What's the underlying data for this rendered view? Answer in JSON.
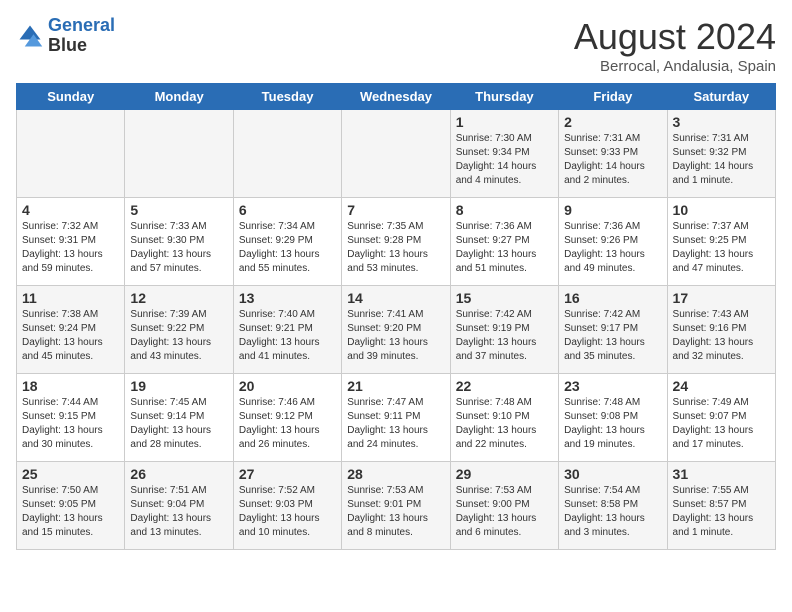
{
  "header": {
    "logo_line1": "General",
    "logo_line2": "Blue",
    "month_year": "August 2024",
    "location": "Berrocal, Andalusia, Spain"
  },
  "days_of_week": [
    "Sunday",
    "Monday",
    "Tuesday",
    "Wednesday",
    "Thursday",
    "Friday",
    "Saturday"
  ],
  "weeks": [
    [
      {
        "num": "",
        "info": ""
      },
      {
        "num": "",
        "info": ""
      },
      {
        "num": "",
        "info": ""
      },
      {
        "num": "",
        "info": ""
      },
      {
        "num": "1",
        "info": "Sunrise: 7:30 AM\nSunset: 9:34 PM\nDaylight: 14 hours\nand 4 minutes."
      },
      {
        "num": "2",
        "info": "Sunrise: 7:31 AM\nSunset: 9:33 PM\nDaylight: 14 hours\nand 2 minutes."
      },
      {
        "num": "3",
        "info": "Sunrise: 7:31 AM\nSunset: 9:32 PM\nDaylight: 14 hours\nand 1 minute."
      }
    ],
    [
      {
        "num": "4",
        "info": "Sunrise: 7:32 AM\nSunset: 9:31 PM\nDaylight: 13 hours\nand 59 minutes."
      },
      {
        "num": "5",
        "info": "Sunrise: 7:33 AM\nSunset: 9:30 PM\nDaylight: 13 hours\nand 57 minutes."
      },
      {
        "num": "6",
        "info": "Sunrise: 7:34 AM\nSunset: 9:29 PM\nDaylight: 13 hours\nand 55 minutes."
      },
      {
        "num": "7",
        "info": "Sunrise: 7:35 AM\nSunset: 9:28 PM\nDaylight: 13 hours\nand 53 minutes."
      },
      {
        "num": "8",
        "info": "Sunrise: 7:36 AM\nSunset: 9:27 PM\nDaylight: 13 hours\nand 51 minutes."
      },
      {
        "num": "9",
        "info": "Sunrise: 7:36 AM\nSunset: 9:26 PM\nDaylight: 13 hours\nand 49 minutes."
      },
      {
        "num": "10",
        "info": "Sunrise: 7:37 AM\nSunset: 9:25 PM\nDaylight: 13 hours\nand 47 minutes."
      }
    ],
    [
      {
        "num": "11",
        "info": "Sunrise: 7:38 AM\nSunset: 9:24 PM\nDaylight: 13 hours\nand 45 minutes."
      },
      {
        "num": "12",
        "info": "Sunrise: 7:39 AM\nSunset: 9:22 PM\nDaylight: 13 hours\nand 43 minutes."
      },
      {
        "num": "13",
        "info": "Sunrise: 7:40 AM\nSunset: 9:21 PM\nDaylight: 13 hours\nand 41 minutes."
      },
      {
        "num": "14",
        "info": "Sunrise: 7:41 AM\nSunset: 9:20 PM\nDaylight: 13 hours\nand 39 minutes."
      },
      {
        "num": "15",
        "info": "Sunrise: 7:42 AM\nSunset: 9:19 PM\nDaylight: 13 hours\nand 37 minutes."
      },
      {
        "num": "16",
        "info": "Sunrise: 7:42 AM\nSunset: 9:17 PM\nDaylight: 13 hours\nand 35 minutes."
      },
      {
        "num": "17",
        "info": "Sunrise: 7:43 AM\nSunset: 9:16 PM\nDaylight: 13 hours\nand 32 minutes."
      }
    ],
    [
      {
        "num": "18",
        "info": "Sunrise: 7:44 AM\nSunset: 9:15 PM\nDaylight: 13 hours\nand 30 minutes."
      },
      {
        "num": "19",
        "info": "Sunrise: 7:45 AM\nSunset: 9:14 PM\nDaylight: 13 hours\nand 28 minutes."
      },
      {
        "num": "20",
        "info": "Sunrise: 7:46 AM\nSunset: 9:12 PM\nDaylight: 13 hours\nand 26 minutes."
      },
      {
        "num": "21",
        "info": "Sunrise: 7:47 AM\nSunset: 9:11 PM\nDaylight: 13 hours\nand 24 minutes."
      },
      {
        "num": "22",
        "info": "Sunrise: 7:48 AM\nSunset: 9:10 PM\nDaylight: 13 hours\nand 22 minutes."
      },
      {
        "num": "23",
        "info": "Sunrise: 7:48 AM\nSunset: 9:08 PM\nDaylight: 13 hours\nand 19 minutes."
      },
      {
        "num": "24",
        "info": "Sunrise: 7:49 AM\nSunset: 9:07 PM\nDaylight: 13 hours\nand 17 minutes."
      }
    ],
    [
      {
        "num": "25",
        "info": "Sunrise: 7:50 AM\nSunset: 9:05 PM\nDaylight: 13 hours\nand 15 minutes."
      },
      {
        "num": "26",
        "info": "Sunrise: 7:51 AM\nSunset: 9:04 PM\nDaylight: 13 hours\nand 13 minutes."
      },
      {
        "num": "27",
        "info": "Sunrise: 7:52 AM\nSunset: 9:03 PM\nDaylight: 13 hours\nand 10 minutes."
      },
      {
        "num": "28",
        "info": "Sunrise: 7:53 AM\nSunset: 9:01 PM\nDaylight: 13 hours\nand 8 minutes."
      },
      {
        "num": "29",
        "info": "Sunrise: 7:53 AM\nSunset: 9:00 PM\nDaylight: 13 hours\nand 6 minutes."
      },
      {
        "num": "30",
        "info": "Sunrise: 7:54 AM\nSunset: 8:58 PM\nDaylight: 13 hours\nand 3 minutes."
      },
      {
        "num": "31",
        "info": "Sunrise: 7:55 AM\nSunset: 8:57 PM\nDaylight: 13 hours\nand 1 minute."
      }
    ]
  ]
}
